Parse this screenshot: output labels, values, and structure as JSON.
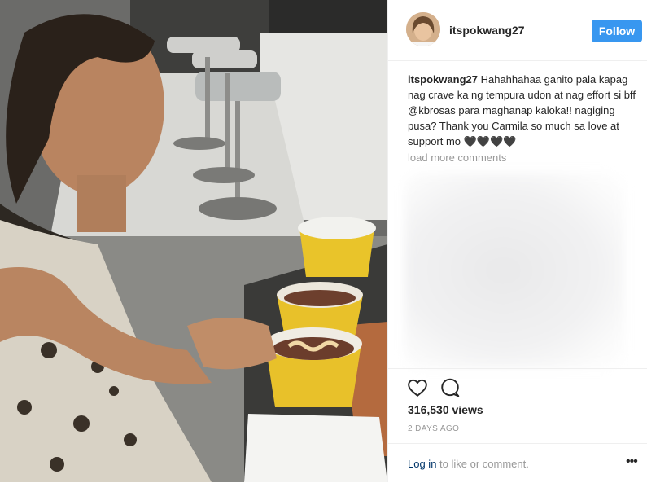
{
  "post": {
    "username": "itspokwang27",
    "follow_label": "Follow",
    "caption_user": "itspokwang27",
    "caption_text": "Hahahhahaa ganito pala kapag nag crave ka ng tempura udon at nag effort si bff @kbrosas para maghanap kaloka!! nagiging pusa? Thank you Carmila so much sa love at support mo 🖤🖤🖤🖤",
    "load_more": "load more comments",
    "views": "316,530 views",
    "date": "2 DAYS AGO",
    "login_link": "Log in",
    "login_rest": " to like or comment.",
    "more_label": "•••"
  },
  "icons": [
    "heart-icon",
    "comment-icon",
    "more-options-icon"
  ],
  "colors": {
    "follow_bg": "#3897f0",
    "username": "#262626",
    "muted": "#999999",
    "link": "#003569"
  }
}
